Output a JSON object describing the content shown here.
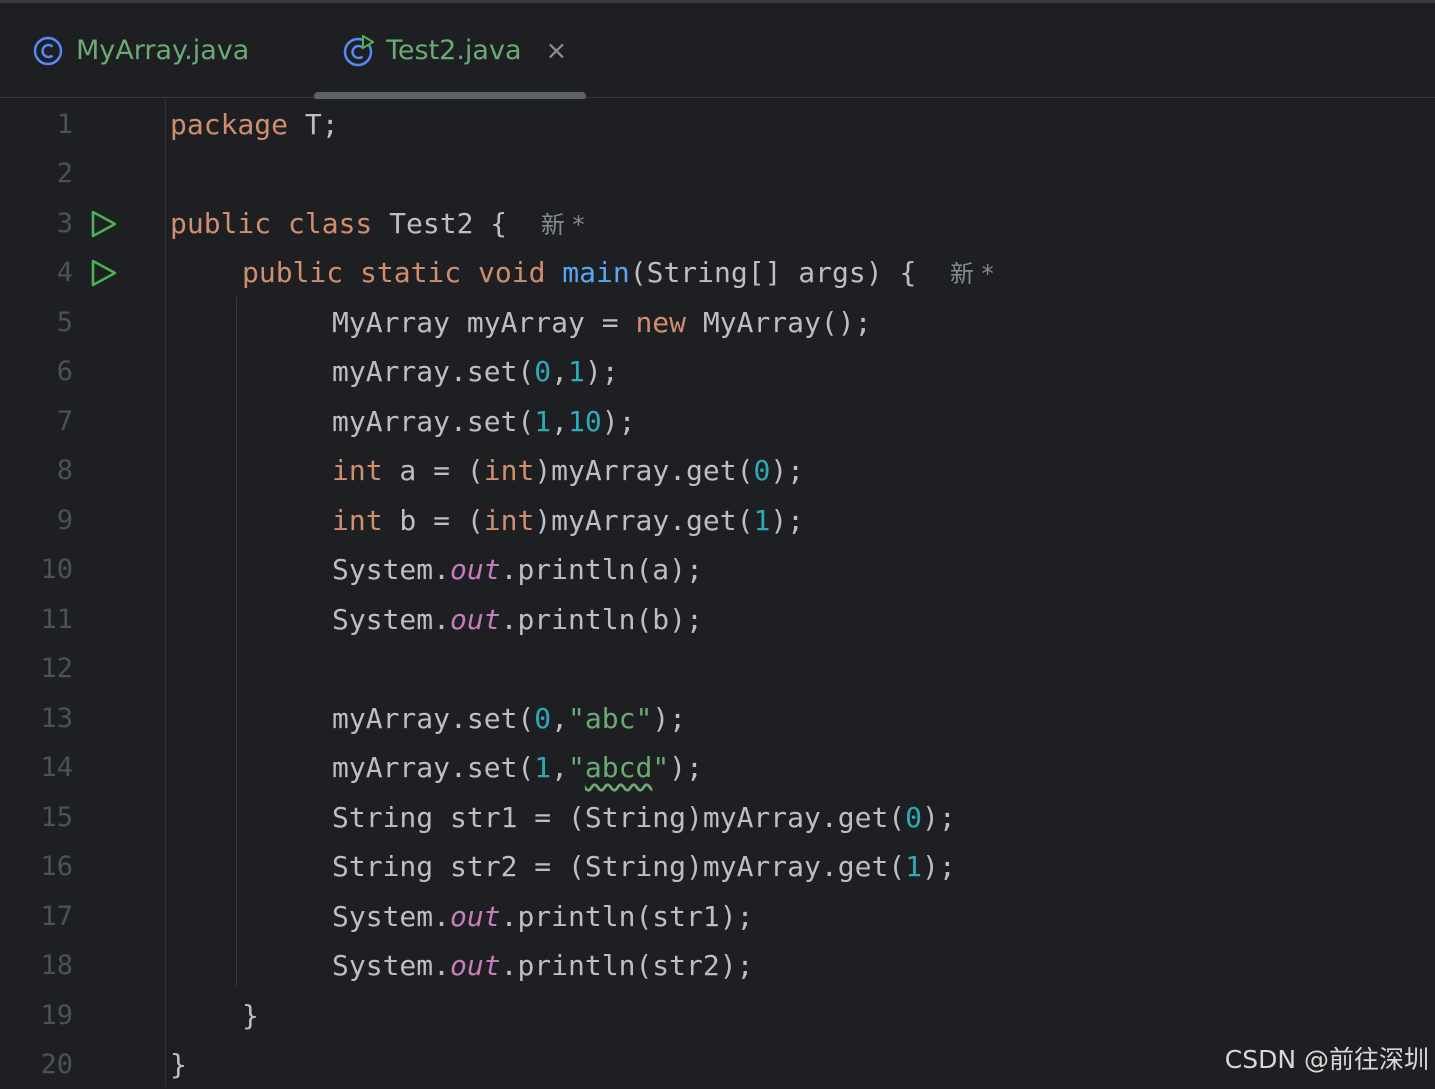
{
  "tabs": [
    {
      "label": "MyArray.java",
      "icon": "class-icon",
      "active": false
    },
    {
      "label": "Test2.java",
      "icon": "runnable-class-icon",
      "active": true,
      "close": "×"
    }
  ],
  "editor": {
    "line_numbers": [
      "1",
      "2",
      "3",
      "4",
      "5",
      "6",
      "7",
      "8",
      "9",
      "10",
      "11",
      "12",
      "13",
      "14",
      "15",
      "16",
      "17",
      "18",
      "19",
      "20"
    ],
    "lines": {
      "l1_kw": "package",
      "l1_rest": " T;",
      "l3_kw": "public class",
      "l3_rest": " Test2 {",
      "l3_hint": "新 *",
      "l4_kw1": "public static void",
      "l4_fn": "main",
      "l4_rest": "(String[] args) {",
      "l4_hint": "新 *",
      "l5_a": "MyArray myArray = ",
      "l5_kw": "new",
      "l5_b": " MyArray();",
      "l6_a": "myArray.set(",
      "l6_n1": "0",
      "l6_c": ",",
      "l6_n2": "1",
      "l6_b": ");",
      "l7_a": "myArray.set(",
      "l7_n1": "1",
      "l7_c": ",",
      "l7_n2": "10",
      "l7_b": ");",
      "l8_kw1": "int",
      "l8_a": " a = (",
      "l8_kw2": "int",
      "l8_b": ")myArray.get(",
      "l8_n": "0",
      "l8_c": ");",
      "l9_kw1": "int",
      "l9_a": " b = (",
      "l9_kw2": "int",
      "l9_b": ")myArray.get(",
      "l9_n": "1",
      "l9_c": ");",
      "l10_a": "System.",
      "l10_f": "out",
      "l10_b": ".println(a);",
      "l11_a": "System.",
      "l11_f": "out",
      "l11_b": ".println(b);",
      "l13_a": "myArray.set(",
      "l13_n": "0",
      "l13_c": ",",
      "l13_s": "\"abc\"",
      "l13_b": ");",
      "l14_a": "myArray.set(",
      "l14_n": "1",
      "l14_c": ",",
      "l14_q1": "\"",
      "l14_s": "abcd",
      "l14_q2": "\"",
      "l14_b": ");",
      "l15_a": "String str1 = (String)myArray.get(",
      "l15_n": "0",
      "l15_b": ");",
      "l16_a": "String str2 = (String)myArray.get(",
      "l16_n": "1",
      "l16_b": ");",
      "l17_a": "System.",
      "l17_f": "out",
      "l17_b": ".println(str1);",
      "l18_a": "System.",
      "l18_f": "out",
      "l18_b": ".println(str2);",
      "l19": "}",
      "l20": "}"
    }
  },
  "watermark": "CSDN @前往深圳",
  "colors": {
    "background": "#1e1f22",
    "keyword": "#cf8e6d",
    "function": "#56a8f5",
    "number": "#2aacb8",
    "string": "#6aab73",
    "field": "#c77dbb",
    "text": "#bcbec4",
    "run_icon": "#4caf50"
  }
}
